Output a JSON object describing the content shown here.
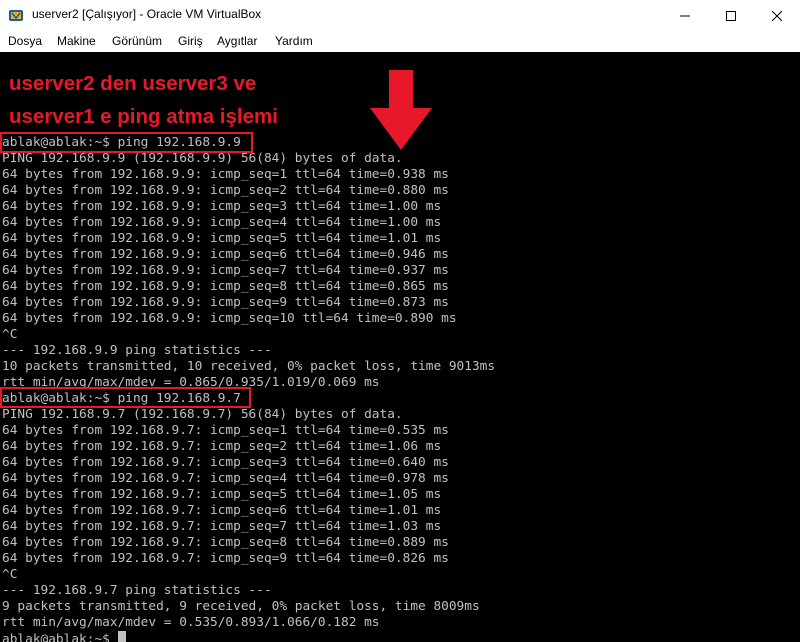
{
  "window": {
    "title": "userver2 [Çalışıyor] - Oracle VM VirtualBox",
    "minimize_icon": "minimize-icon",
    "maximize_icon": "maximize-icon",
    "close_icon": "close-icon",
    "app_icon": "virtualbox-icon"
  },
  "menu": {
    "items": [
      "Dosya",
      "Makine",
      "Görünüm",
      "Giriş",
      "Aygıtlar",
      "Yardım"
    ]
  },
  "annotation": {
    "line1": "userver2 den userver3 ve",
    "line2": "userver1 e ping atma işlemi",
    "color": "#e8182b",
    "arrow_icon": "down-arrow-icon"
  },
  "terminal": {
    "lines": [
      "ablak@ablak:~$ ping 192.168.9.9",
      "PING 192.168.9.9 (192.168.9.9) 56(84) bytes of data.",
      "64 bytes from 192.168.9.9: icmp_seq=1 ttl=64 time=0.938 ms",
      "64 bytes from 192.168.9.9: icmp_seq=2 ttl=64 time=0.880 ms",
      "64 bytes from 192.168.9.9: icmp_seq=3 ttl=64 time=1.00 ms",
      "64 bytes from 192.168.9.9: icmp_seq=4 ttl=64 time=1.00 ms",
      "64 bytes from 192.168.9.9: icmp_seq=5 ttl=64 time=1.01 ms",
      "64 bytes from 192.168.9.9: icmp_seq=6 ttl=64 time=0.946 ms",
      "64 bytes from 192.168.9.9: icmp_seq=7 ttl=64 time=0.937 ms",
      "64 bytes from 192.168.9.9: icmp_seq=8 ttl=64 time=0.865 ms",
      "64 bytes from 192.168.9.9: icmp_seq=9 ttl=64 time=0.873 ms",
      "64 bytes from 192.168.9.9: icmp_seq=10 ttl=64 time=0.890 ms",
      "^C",
      "--- 192.168.9.9 ping statistics ---",
      "10 packets transmitted, 10 received, 0% packet loss, time 9013ms",
      "rtt min/avg/max/mdev = 0.865/0.935/1.019/0.069 ms",
      "ablak@ablak:~$ ping 192.168.9.7",
      "PING 192.168.9.7 (192.168.9.7) 56(84) bytes of data.",
      "64 bytes from 192.168.9.7: icmp_seq=1 ttl=64 time=0.535 ms",
      "64 bytes from 192.168.9.7: icmp_seq=2 ttl=64 time=1.06 ms",
      "64 bytes from 192.168.9.7: icmp_seq=3 ttl=64 time=0.640 ms",
      "64 bytes from 192.168.9.7: icmp_seq=4 ttl=64 time=0.978 ms",
      "64 bytes from 192.168.9.7: icmp_seq=5 ttl=64 time=1.05 ms",
      "64 bytes from 192.168.9.7: icmp_seq=6 ttl=64 time=1.01 ms",
      "64 bytes from 192.168.9.7: icmp_seq=7 ttl=64 time=1.03 ms",
      "64 bytes from 192.168.9.7: icmp_seq=8 ttl=64 time=0.889 ms",
      "64 bytes from 192.168.9.7: icmp_seq=9 ttl=64 time=0.826 ms",
      "^C",
      "--- 192.168.9.7 ping statistics ---",
      "9 packets transmitted, 9 received, 0% packet loss, time 8009ms",
      "rtt min/avg/max/mdev = 0.535/0.893/1.066/0.182 ms"
    ],
    "prompt": "ablak@ablak:~$ "
  }
}
